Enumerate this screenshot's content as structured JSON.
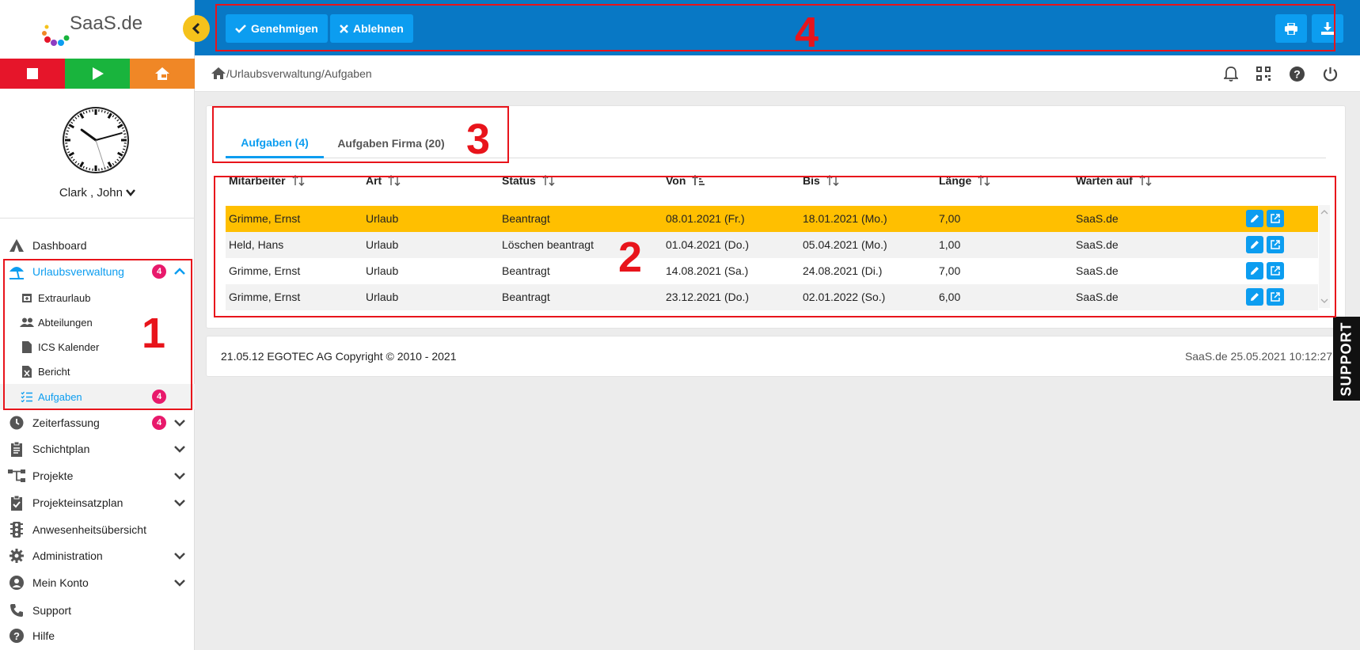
{
  "app": {
    "logo_text": "SaaS.de"
  },
  "colors": {
    "accent": "#0c9df0",
    "topbar": "#0878c5",
    "highlight_row": "#ffbf00",
    "badge": "#e8196b",
    "stop": "#e6152a",
    "play": "#19b43d",
    "home": "#f08726",
    "annotation": "#e8141b"
  },
  "user": {
    "name": "Clark , John"
  },
  "clock": {
    "hour": 10,
    "minute": 12,
    "second": 27
  },
  "sidebar": {
    "items": [
      {
        "label": "Dashboard",
        "icon": "tent-icon"
      },
      {
        "label": "Urlaubsverwaltung",
        "icon": "beach-umbrella-icon",
        "badge": "4",
        "active": true
      },
      {
        "label": "Extraurlaub",
        "icon": "calendar-plus-icon"
      },
      {
        "label": "Abteilungen",
        "icon": "people-icon"
      },
      {
        "label": "ICS Kalender",
        "icon": "file-icon"
      },
      {
        "label": "Bericht",
        "icon": "excel-file-icon"
      },
      {
        "label": "Aufgaben",
        "icon": "task-list-icon",
        "badge": "4",
        "active": true
      },
      {
        "label": "Zeiterfassung",
        "icon": "clock-icon",
        "badge": "4"
      },
      {
        "label": "Schichtplan",
        "icon": "clipboard-icon"
      },
      {
        "label": "Projekte",
        "icon": "hierarchy-icon"
      },
      {
        "label": "Projekteinsatzplan",
        "icon": "clipboard-check-icon"
      },
      {
        "label": "Anwesenheitsübersicht",
        "icon": "traffic-light-icon"
      },
      {
        "label": "Administration",
        "icon": "gear-icon"
      },
      {
        "label": "Mein Konto",
        "icon": "account-icon"
      },
      {
        "label": "Support",
        "icon": "phone-icon"
      },
      {
        "label": "Hilfe",
        "icon": "help-icon"
      }
    ]
  },
  "toolbar": {
    "approve_label": "Genehmigen",
    "reject_label": "Ablehnen"
  },
  "breadcrumb": {
    "path": "/Urlaubsverwaltung/Aufgaben"
  },
  "tabs": [
    {
      "label": "Aufgaben (4)",
      "active": true
    },
    {
      "label": "Aufgaben Firma (20)",
      "active": false
    }
  ],
  "table": {
    "columns": [
      "Mitarbeiter",
      "Art",
      "Status",
      "Von",
      "Bis",
      "Länge",
      "Warten auf"
    ],
    "rows": [
      [
        "Grimme, Ernst",
        "Urlaub",
        "Beantragt",
        "08.01.2021 (Fr.)",
        "18.01.2021 (Mo.)",
        "7,00",
        "SaaS.de"
      ],
      [
        "Held, Hans",
        "Urlaub",
        "Löschen beantragt",
        "01.04.2021 (Do.)",
        "05.04.2021 (Mo.)",
        "1,00",
        "SaaS.de"
      ],
      [
        "Grimme, Ernst",
        "Urlaub",
        "Beantragt",
        "14.08.2021 (Sa.)",
        "24.08.2021 (Di.)",
        "7,00",
        "SaaS.de"
      ],
      [
        "Grimme, Ernst",
        "Urlaub",
        "Beantragt",
        "23.12.2021 (Do.)",
        "02.01.2022 (So.)",
        "6,00",
        "SaaS.de"
      ]
    ]
  },
  "footer": {
    "left": "21.05.12 EGOTEC AG Copyright © 2010 - 2021",
    "right": "SaaS.de  25.05.2021 10:12:27"
  },
  "support_tab": "SUPPORT",
  "annotations": [
    "1",
    "2",
    "3",
    "4"
  ]
}
